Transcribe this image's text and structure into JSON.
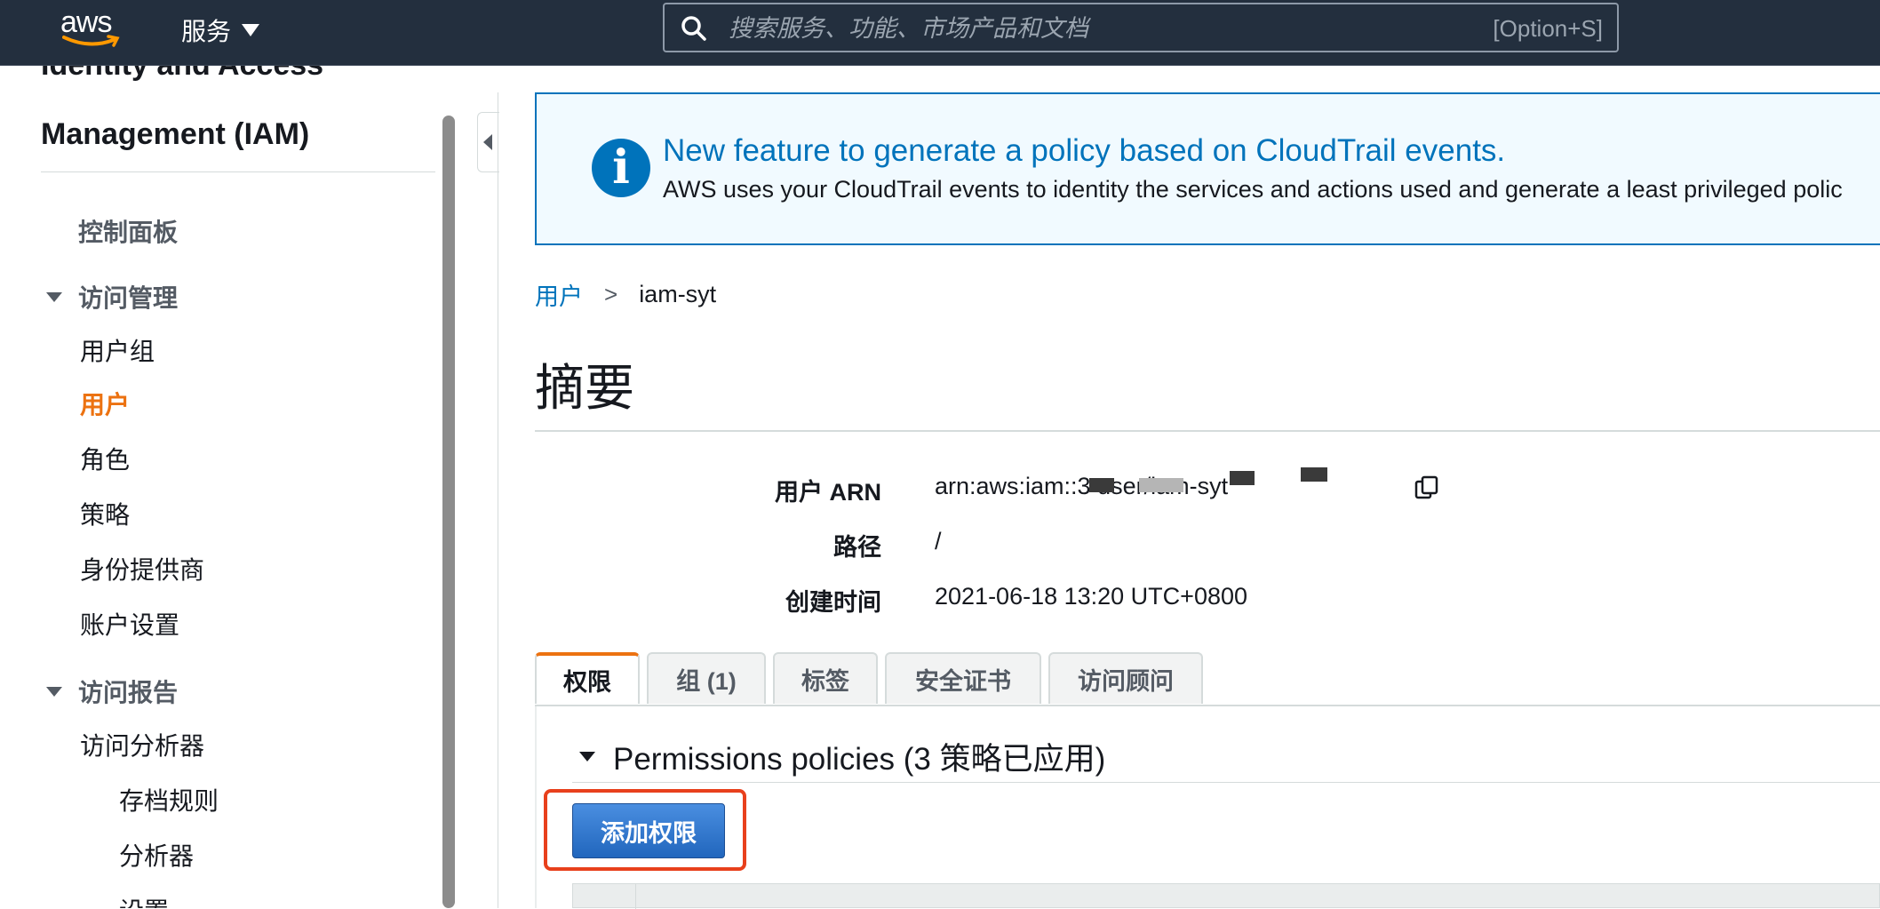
{
  "topnav": {
    "logo_text": "aws",
    "services_label": "服务",
    "search_placeholder": "搜索服务、功能、市场产品和文档",
    "search_hint": "[Option+S]"
  },
  "sidebar": {
    "title_line1": "Identity and Access",
    "title_line2": "Management (IAM)",
    "dashboard": "控制面板",
    "section_access_mgmt": "访问管理",
    "items_access": [
      "用户组",
      "用户",
      "角色",
      "策略",
      "身份提供商",
      "账户设置"
    ],
    "active_item": "用户",
    "section_access_reports": "访问报告",
    "items_reports": [
      "访问分析器"
    ],
    "items_analyzer": [
      "存档规则",
      "分析器",
      "设置"
    ]
  },
  "banner": {
    "title": "New feature to generate a policy based on CloudTrail events.",
    "text": "AWS uses your CloudTrail events to identity the services and actions used and generate a least privileged polic"
  },
  "breadcrumb": {
    "parent": "用户",
    "separator": ">",
    "current": "iam-syt"
  },
  "summary": {
    "title": "摘要",
    "arn_label": "用户 ARN",
    "arn_value": "arn:aws:iam::3            user/iam-syt",
    "path_label": "路径",
    "path_value": "/",
    "created_label": "创建时间",
    "created_value": "2021-06-18 13:20 UTC+0800"
  },
  "tabs": [
    "权限",
    "组 (1)",
    "标签",
    "安全证书",
    "访问顾问"
  ],
  "permissions": {
    "header": "Permissions policies (3 策略已应用)",
    "add_button": "添加权限"
  },
  "colors": {
    "nav_bg": "#232f3e",
    "link": "#0073bb",
    "active_orange": "#ec7211",
    "highlight_red": "#e8401c",
    "button_blue": "#2166bd"
  }
}
